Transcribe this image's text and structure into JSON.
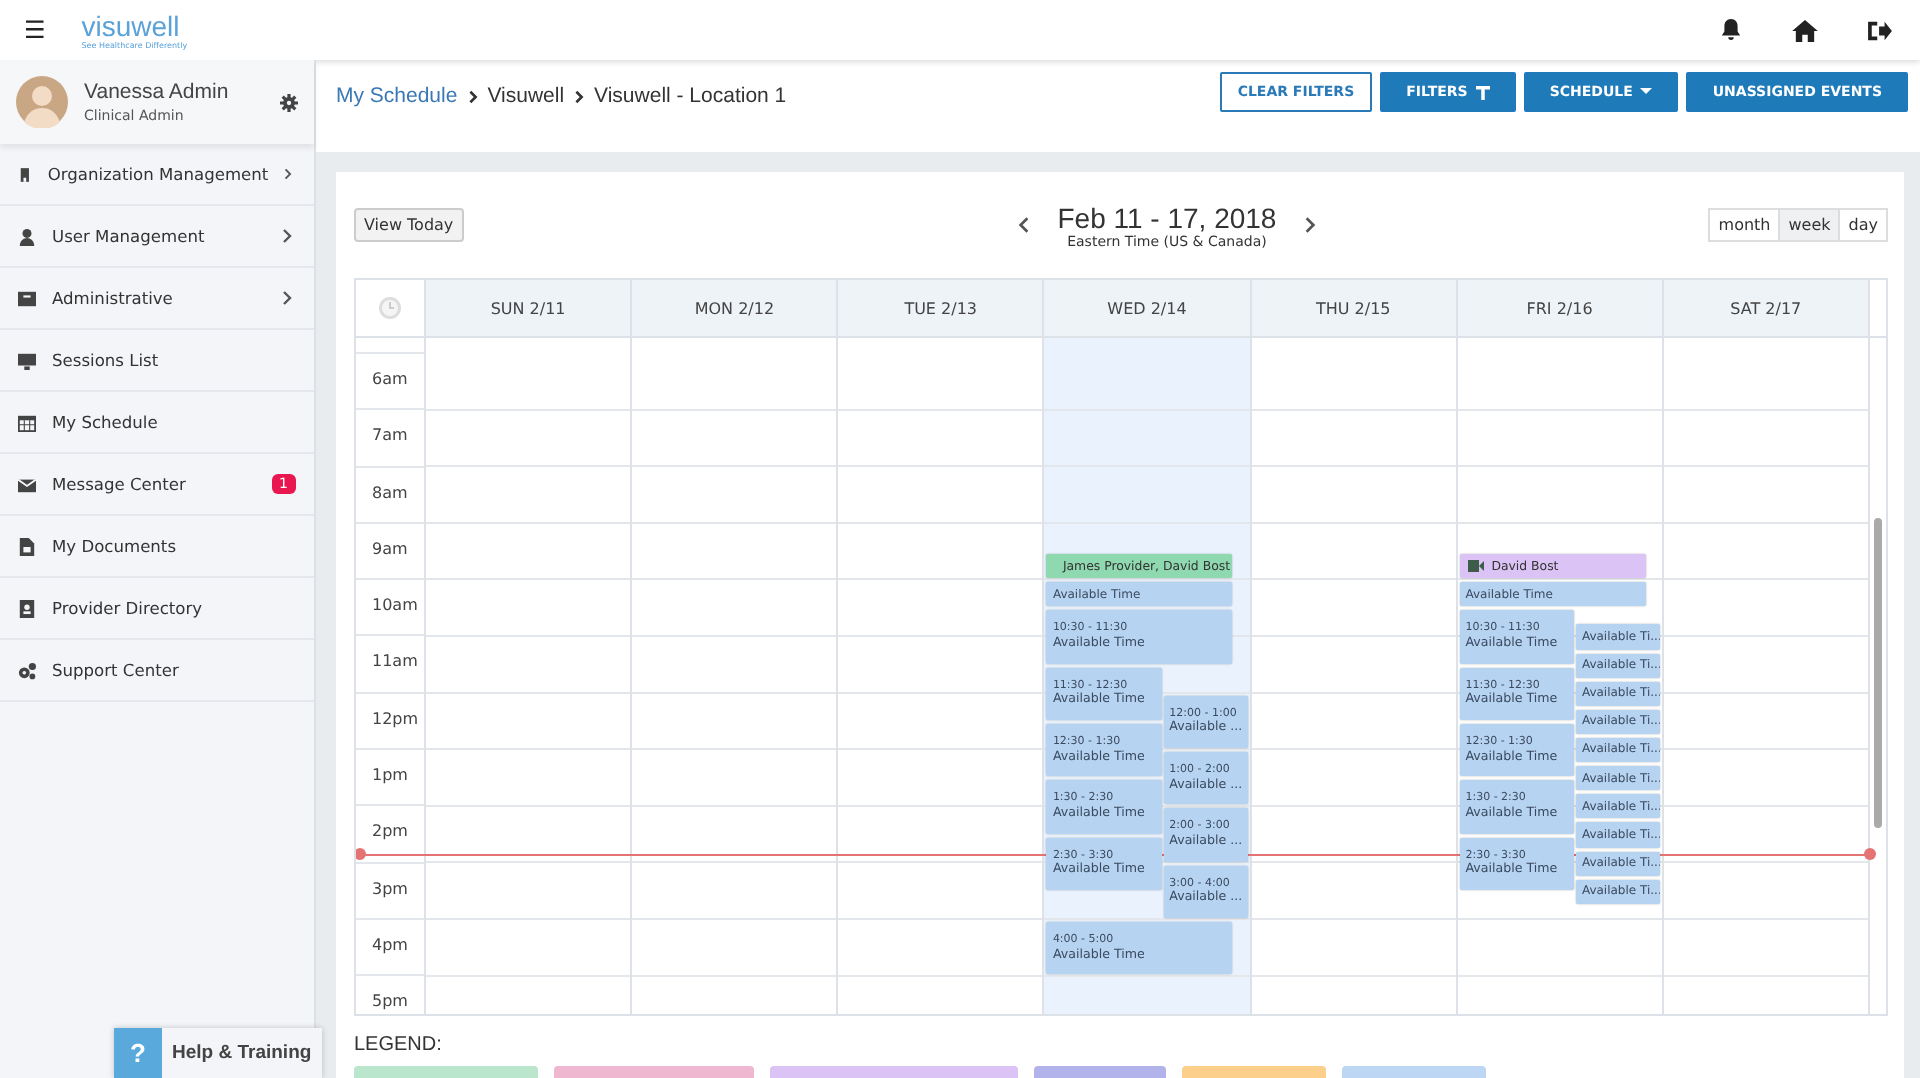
{
  "topbar": {
    "logo": "visuwell",
    "tagline": "See Healthcare Differently",
    "menu_icon": "☰"
  },
  "user": {
    "name": "Vanessa Admin",
    "role": "Clinical Admin"
  },
  "sidebar": {
    "items": [
      {
        "label": "Organization Management",
        "expandable": true
      },
      {
        "label": "User Management",
        "expandable": true
      },
      {
        "label": "Administrative",
        "expandable": true
      },
      {
        "label": "Sessions List",
        "expandable": false
      },
      {
        "label": "My Schedule",
        "expandable": false
      },
      {
        "label": "Message Center",
        "expandable": false,
        "badge": "1"
      },
      {
        "label": "My Documents",
        "expandable": false
      },
      {
        "label": "Provider Directory",
        "expandable": false
      },
      {
        "label": "Support Center",
        "expandable": false
      }
    ]
  },
  "breadcrumb": [
    {
      "label": "My Schedule",
      "link": true
    },
    {
      "label": "Visuwell",
      "link": false
    },
    {
      "label": "Visuwell - Location 1",
      "link": false
    }
  ],
  "actions": [
    {
      "label": "CLEAR FILTERS",
      "kind": "outline"
    },
    {
      "label": "FILTERS",
      "kind": "filter"
    },
    {
      "label": "SCHEDULE",
      "kind": "dropdown"
    },
    {
      "label": "UNASSIGNED EVENTS",
      "kind": "solid"
    }
  ],
  "calendar": {
    "today_button": "View Today",
    "title": "Feb 11 - 17, 2018",
    "timezone": "Eastern Time (US & Canada)",
    "views": [
      {
        "label": "month",
        "selected": false
      },
      {
        "label": "week",
        "selected": true
      },
      {
        "label": "day",
        "selected": false
      }
    ],
    "days": [
      {
        "label": "SUN 2/11",
        "today": false
      },
      {
        "label": "MON 2/12",
        "today": false
      },
      {
        "label": "TUE 2/13",
        "today": false
      },
      {
        "label": "WED 2/14",
        "today": true,
        "events": [
          {
            "kind": "video",
            "title": "James Provider, David Bost",
            "color": "#8fd9b0"
          },
          {
            "kind": "available",
            "title": "Available Time"
          },
          {
            "kind": "available",
            "time": "10:30 - 11:30",
            "title": "Available Time"
          },
          {
            "kind": "available",
            "time": "11:30 - 12:30",
            "title": "Available Time"
          },
          {
            "kind": "available",
            "time": "12:30 - 1:30",
            "title": "Available Time"
          },
          {
            "kind": "available",
            "time": "1:30 - 2:30",
            "title": "Available Time"
          },
          {
            "kind": "available",
            "time": "2:30 - 3:30",
            "title": "Available Time"
          },
          {
            "kind": "available",
            "time": "12:00 - 1:00",
            "title": "Available ..."
          },
          {
            "kind": "available",
            "time": "1:00 - 2:00",
            "title": "Available ..."
          },
          {
            "kind": "available",
            "time": "2:00 - 3:00",
            "title": "Available ..."
          },
          {
            "kind": "available",
            "time": "3:00 - 4:00",
            "title": "Available ..."
          },
          {
            "kind": "available",
            "time": "4:00 - 5:00",
            "title": "Available Time"
          }
        ]
      },
      {
        "label": "THU 2/15",
        "today": false
      },
      {
        "label": "FRI 2/16",
        "today": false,
        "events": [
          {
            "kind": "video",
            "title": "David Bost",
            "color": "#dcc3f5"
          },
          {
            "kind": "available",
            "title": "Available Time"
          },
          {
            "kind": "available",
            "time": "10:30 - 11:30",
            "title": "Available Time"
          },
          {
            "kind": "available",
            "time": "11:30 - 12:30",
            "title": "Available Time"
          },
          {
            "kind": "available",
            "time": "12:30 - 1:30",
            "title": "Available Time"
          },
          {
            "kind": "available",
            "time": "1:30 - 2:30",
            "title": "Available Time"
          },
          {
            "kind": "available",
            "time": "2:30 - 3:30",
            "title": "Available Time"
          },
          {
            "kind": "available",
            "title": "Available Ti..."
          },
          {
            "kind": "available",
            "title": "Available Ti..."
          },
          {
            "kind": "available",
            "title": "Available Ti..."
          },
          {
            "kind": "available",
            "title": "Available Ti..."
          },
          {
            "kind": "available",
            "title": "Available Ti..."
          },
          {
            "kind": "available",
            "title": "Available Ti..."
          },
          {
            "kind": "available",
            "title": "Available Ti..."
          },
          {
            "kind": "available",
            "title": "Available Ti..."
          },
          {
            "kind": "available",
            "title": "Available Ti..."
          },
          {
            "kind": "available",
            "title": "Available Ti..."
          }
        ]
      },
      {
        "label": "SAT 2/17",
        "today": false
      }
    ],
    "hours": [
      "6am",
      "7am",
      "8am",
      "9am",
      "10am",
      "11am",
      "12pm",
      "1pm",
      "2pm",
      "3pm",
      "4pm",
      "5pm"
    ]
  },
  "legend": {
    "title": "LEGEND:",
    "items": [
      {
        "color": "#b9e6cc"
      },
      {
        "color": "#f0b8d0"
      },
      {
        "color": "#dcc3f5"
      },
      {
        "color": "#b3b3ec"
      },
      {
        "color": "#fcd08a"
      },
      {
        "color": "#bcd6f3"
      }
    ]
  },
  "help": {
    "icon": "?",
    "label": "Help & Training"
  }
}
